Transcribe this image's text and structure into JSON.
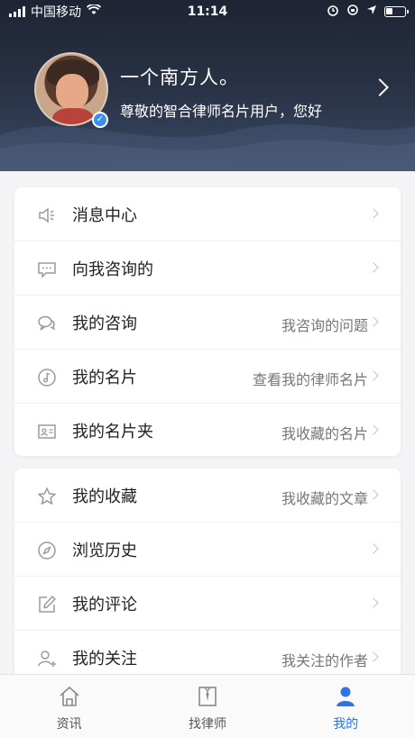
{
  "status_bar": {
    "carrier": "中国移动",
    "time": "11:14"
  },
  "profile": {
    "name": "一个南方人。",
    "subtitle": "尊敬的智合律师名片用户，您好"
  },
  "menu_group_1": [
    {
      "label": "消息中心",
      "value": "",
      "icon": "speaker-icon"
    },
    {
      "label": "向我咨询的",
      "value": "",
      "icon": "chat-bubble-icon"
    },
    {
      "label": "我的咨询",
      "value": "我咨询的问题",
      "icon": "chat-bubbles-icon"
    },
    {
      "label": "我的名片",
      "value": "查看我的律师名片",
      "icon": "music-note-icon"
    },
    {
      "label": "我的名片夹",
      "value": "我收藏的名片",
      "icon": "contact-card-icon"
    }
  ],
  "menu_group_2": [
    {
      "label": "我的收藏",
      "value": "我收藏的文章",
      "icon": "star-icon"
    },
    {
      "label": "浏览历史",
      "value": "",
      "icon": "compass-icon"
    },
    {
      "label": "我的评论",
      "value": "",
      "icon": "edit-icon"
    },
    {
      "label": "我的关注",
      "value": "我关注的作者",
      "icon": "add-user-icon"
    }
  ],
  "tabs": [
    {
      "label": "资讯",
      "icon": "home-icon",
      "active": false
    },
    {
      "label": "找律师",
      "icon": "lawyer-icon",
      "active": false
    },
    {
      "label": "我的",
      "icon": "user-icon",
      "active": true
    }
  ],
  "colors": {
    "accent": "#2f73e6",
    "header_dark": "#1e2433"
  }
}
